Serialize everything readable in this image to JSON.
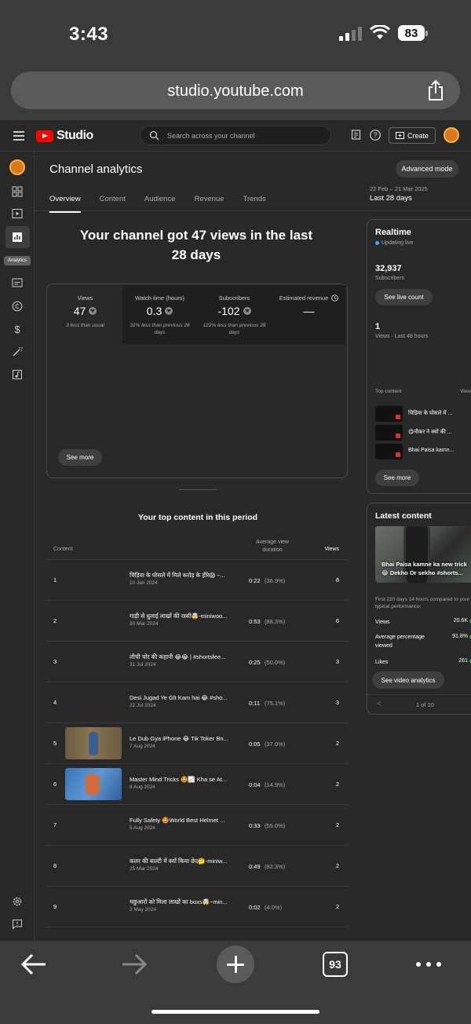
{
  "status": {
    "time": "3:43",
    "battery": "83"
  },
  "browser": {
    "url": "studio.youtube.com",
    "tab_count": "93"
  },
  "header": {
    "studio_label": "Studio",
    "search_placeholder": "Search across your channel",
    "create_label": "Create"
  },
  "rail": {
    "tooltip": "Analytics"
  },
  "page": {
    "title": "Channel analytics",
    "advanced_mode": "Advanced mode",
    "tabs": [
      "Overview",
      "Content",
      "Audience",
      "Revenue",
      "Trends"
    ],
    "date_range": "22 Feb – 21 Mar 2025",
    "date_label": "Last 28 days",
    "headline": "Your channel got 47 views in the last 28 days"
  },
  "metrics": [
    {
      "label": "Views",
      "value": "47",
      "note": "3 less than usual",
      "trend": "down"
    },
    {
      "label": "Watch time (hours)",
      "value": "0.3",
      "note": "31% less than previous 28 days",
      "trend": "down"
    },
    {
      "label": "Subscribers",
      "value": "-102",
      "note": "122% less than previous 28 days",
      "trend": "down"
    },
    {
      "label": "Estimated revenue",
      "value": "—",
      "note": "",
      "trend": "none"
    }
  ],
  "see_more": "See more",
  "top_content": {
    "title": "Your top content in this period",
    "col_content": "Content",
    "col_avd": "Average view duration",
    "col_views": "Views",
    "rows": [
      {
        "n": "1",
        "title": "चिड़िया के घोसले में मिले करोड़ के हीरे😱 ~...",
        "date": "10 Jan 2024",
        "dur": "0:22",
        "pct": "(36.9%)",
        "views": "8",
        "thumb": "none"
      },
      {
        "n": "2",
        "title": "गाड़ी से धुलाई लाखों की रस्सी🤯-miniwoo...",
        "date": "30 Mar 2024",
        "dur": "0:53",
        "pct": "(88.3%)",
        "views": "6",
        "thumb": "none"
      },
      {
        "n": "3",
        "title": "लीची चोर की कहानी 😂😂 | #shortsfee...",
        "date": "31 Jul 2024",
        "dur": "0:25",
        "pct": "(50.0%)",
        "views": "3",
        "thumb": "none"
      },
      {
        "n": "4",
        "title": "Desi Jugad Ye Glt Kam hai 😂 #sho...",
        "date": "22 Jul 2024",
        "dur": "0:11",
        "pct": "(75.1%)",
        "views": "3",
        "thumb": "none"
      },
      {
        "n": "5",
        "title": "Le Dub Gya iPhone 😂 Tik Toker Bn...",
        "date": "7 Aug 2024",
        "dur": "0:05",
        "pct": "(37.0%)",
        "views": "2",
        "thumb": "brown"
      },
      {
        "n": "6",
        "title": "Master Mind Tricks 🤩📈 Kha se At...",
        "date": "8 Aug 2024",
        "dur": "0:04",
        "pct": "(14.9%)",
        "views": "2",
        "thumb": "blue"
      },
      {
        "n": "7",
        "title": "Fully Safety 🤩World Best Helmet ...",
        "date": "5 Aug 2024",
        "dur": "0:33",
        "pct": "(55.0%)",
        "views": "2",
        "thumb": "none"
      },
      {
        "n": "8",
        "title": "कलर की बाल्टी में क्यों किया छेद🤔-miniw...",
        "date": "25 Mar 2024",
        "dur": "0:49",
        "pct": "(82.3%)",
        "views": "2",
        "thumb": "none"
      },
      {
        "n": "9",
        "title": "मछुआरों को मिला लाखों का boxs🤯~min...",
        "date": "2 May 2024",
        "dur": "0:02",
        "pct": "(4.0%)",
        "views": "2",
        "thumb": "none"
      }
    ]
  },
  "realtime": {
    "title": "Realtime",
    "updating": "Updating live",
    "subs_value": "32,937",
    "subs_label": "Subscribers",
    "live_count_btn": "See live count",
    "views_value": "1",
    "views_label": "Views · Last 48 hours",
    "top_content_label": "Top content",
    "views_header": "View",
    "items": [
      "चिड़िया के घोसले में ...",
      "😋नौकर ने क्यों की ...",
      "Bhai Paisa kamn..."
    ],
    "see_more": "See more"
  },
  "latest": {
    "title": "Latest content",
    "caption_line1": "Bhai Paisa kamne ka new trick",
    "caption_line2": "😂 Dekho Or sekho #shorts...",
    "note": "First 220 days 14 hours compared to your typical performance:",
    "stats": [
      {
        "label": "Views",
        "value": "20.6K"
      },
      {
        "label": "Average percentage viewed",
        "value": "91.8%"
      },
      {
        "label": "Likes",
        "value": "261"
      }
    ],
    "button": "See video analytics",
    "pager": "1 of 10",
    "status_color": "#2ba640"
  }
}
